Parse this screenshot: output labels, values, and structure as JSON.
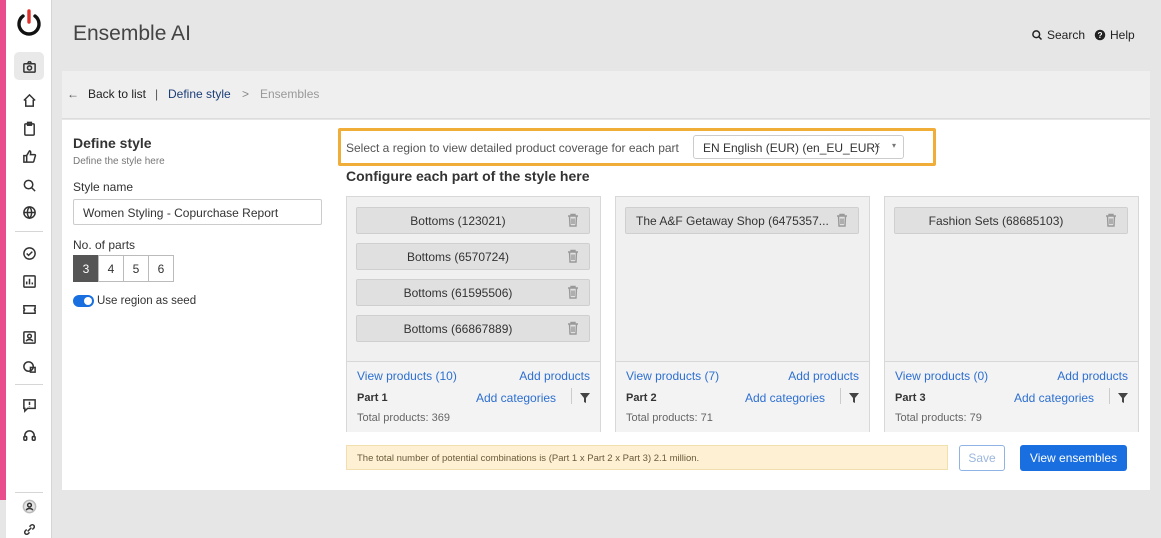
{
  "app": {
    "title": "Ensemble AI"
  },
  "topnav": {
    "search": "Search",
    "help": "Help"
  },
  "breadcrumb": {
    "back": "Back to list",
    "separator": "|",
    "current": "Define style",
    "arrow": ">",
    "next": "Ensembles"
  },
  "left": {
    "heading": "Define style",
    "subheading": "Define the style here",
    "style_name_label": "Style name",
    "style_name_value": "Women Styling - Copurchase Report",
    "parts_label": "No. of parts",
    "part_options": [
      "3",
      "4",
      "5",
      "6"
    ],
    "selected_parts": "3",
    "toggle_label": "Use region as seed",
    "toggle_on": true
  },
  "region": {
    "label": "Select a region to view detailed product coverage for each part",
    "value": "EN English (EUR) (en_EU_EUR)",
    "clear": "×",
    "caret": "▾"
  },
  "configure_heading": "Configure each part of the style here",
  "parts": [
    {
      "items": [
        "Bottoms (123021)",
        "Bottoms (6570724)",
        "Bottoms (61595506)",
        "Bottoms (66867889)"
      ],
      "view_products": "View products (10)",
      "add_products": "Add products",
      "name": "Part 1",
      "add_categories": "Add categories",
      "total": "Total products: 369"
    },
    {
      "items": [
        "The A&F Getaway Shop (6475357..."
      ],
      "view_products": "View products (7)",
      "add_products": "Add products",
      "name": "Part 2",
      "add_categories": "Add categories",
      "total": "Total products: 71"
    },
    {
      "items": [
        "Fashion Sets (68685103)"
      ],
      "view_products": "View products (0)",
      "add_products": "Add products",
      "name": "Part 3",
      "add_categories": "Add categories",
      "total": "Total products: 79"
    }
  ],
  "info": "The total number of potential combinations is (Part 1 x Part 2 x Part 3) 2.1 million.",
  "buttons": {
    "save": "Save",
    "view_ensembles": "View ensembles"
  },
  "colors": {
    "accent": "#1a6fe0",
    "brand_pink": "#e94d8c",
    "highlight": "#f0ad38",
    "info_bg": "#fdf0d3"
  },
  "icons": [
    "power-logo-icon",
    "camera-icon",
    "home-icon",
    "clipboard-icon",
    "thumbs-up-icon",
    "search-icon",
    "globe-icon",
    "badge-check-icon",
    "chart-icon",
    "ticket-icon",
    "contact-icon",
    "shapes-icon",
    "feedback-icon",
    "support-icon",
    "user-icon",
    "link-icon",
    "trash-icon",
    "filter-icon",
    "help-icon"
  ]
}
